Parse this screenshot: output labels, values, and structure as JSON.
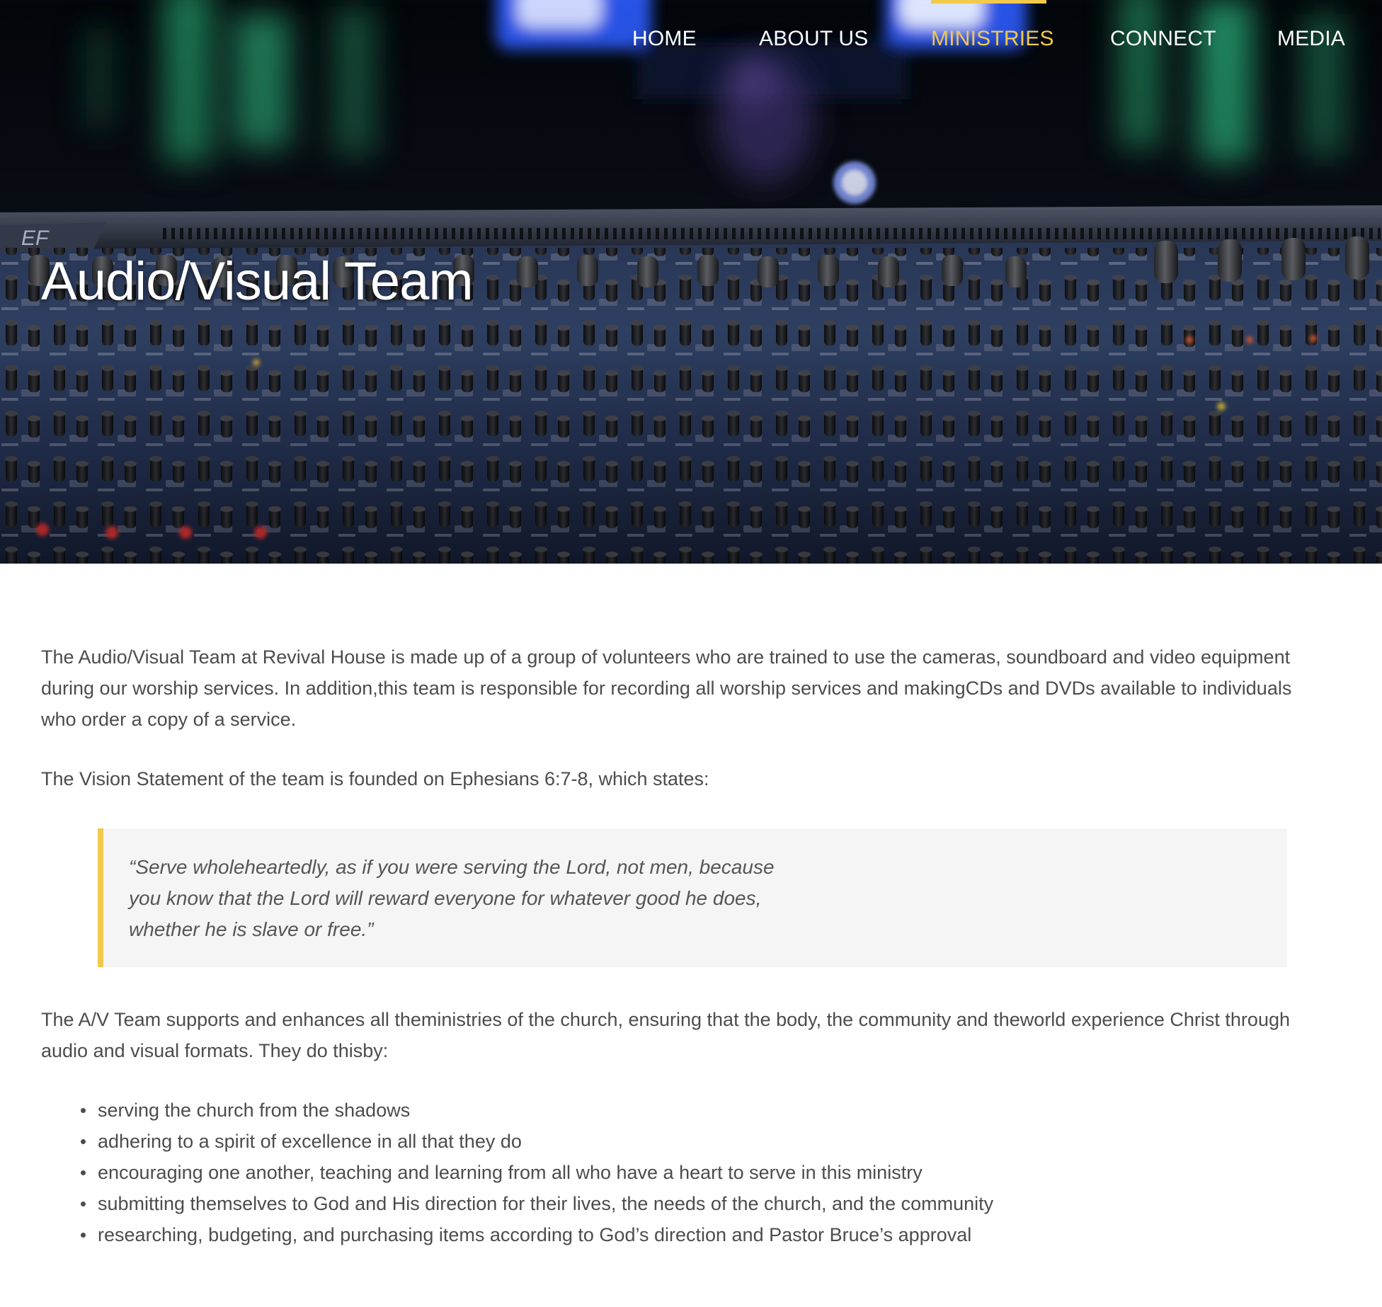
{
  "nav": {
    "items": [
      {
        "label": "HOME",
        "active": false
      },
      {
        "label": "ABOUT US",
        "active": false
      },
      {
        "label": "MINISTRIES",
        "active": true
      },
      {
        "label": "CONNECT",
        "active": false
      },
      {
        "label": "MEDIA",
        "active": false
      }
    ],
    "active_color": "#f2c94c"
  },
  "hero": {
    "title": "Audio/Visual Team",
    "image": "mixing-console-photo"
  },
  "content": {
    "intro": "The Audio/Visual Team at Revival House is made up of a group of volunteers who are trained to use the cameras, soundboard and video equipment during our worship services. In addition,this team is responsible for recording all worship services and makingCDs and DVDs available to individuals who order a copy of a service.",
    "vision": "The Vision Statement of the team is founded on Ephesians 6:7-8, which states:",
    "quote_lines": [
      "“Serve wholeheartedly, as if you were serving the Lord, not men, because",
      "you know that the Lord will reward everyone for whatever good he does,",
      "whether he is slave or free.”"
    ],
    "support": "The A/V Team supports and enhances all theministries of the church, ensuring that the body, the community and theworld experience Christ through audio and visual formats. They do thisby:",
    "bullets": [
      "serving the church from the shadows",
      "adhering to a spirit of excellence in all that they do",
      "encouraging one another, teaching and learning from all who have a heart to serve in this ministry",
      "submitting themselves to God and His direction for their lives, the needs of the church, and the community",
      "researching, budgeting, and purchasing items according to God’s direction and Pastor Bruce’s approval"
    ]
  },
  "colors": {
    "accent": "#f2c94c",
    "body_text": "#4c4c4c",
    "quote_bg": "#f5f5f5"
  }
}
